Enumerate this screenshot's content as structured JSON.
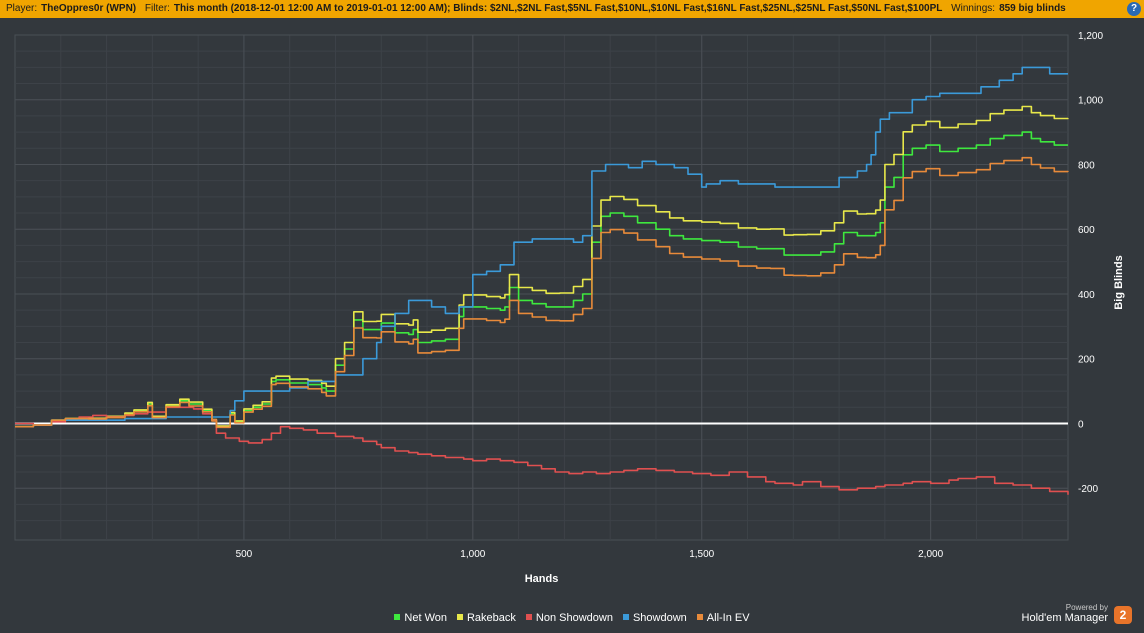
{
  "header": {
    "player_label": "Player:",
    "player_value": "TheOppres0r (WPN)",
    "filter_label": "Filter:",
    "filter_value": "This month (2018-12-01 12:00 AM to 2019-01-01 12:00 AM); Blinds: $2NL,$2NL Fast,$5NL Fast,$10NL,$10NL Fast,$16NL Fast,$25NL,$25NL Fast,$50NL Fast,$100PL",
    "winnings_label": "Winnings:",
    "winnings_value": "859 big blinds",
    "help_glyph": "?"
  },
  "branding": {
    "powered_by": "Powered by",
    "product": "Hold'em Manager",
    "logo_glyph": "2"
  },
  "colors": {
    "background": "#33383d",
    "grid": "#4a4f55",
    "zero_line": "#ffffff",
    "header": "#f0a500"
  },
  "chart_data": {
    "type": "line",
    "xlabel": "Hands",
    "ylabel": "Big Blinds",
    "xlim": [
      0,
      2300
    ],
    "ylim": [
      -360,
      1200
    ],
    "x_ticks": [
      500,
      1000,
      1500,
      2000
    ],
    "x_tick_labels": [
      "500",
      "1,000",
      "1,500",
      "2,000"
    ],
    "y_ticks": [
      -200,
      0,
      200,
      400,
      600,
      800,
      1000,
      1200
    ],
    "y_tick_labels": [
      "-200",
      "0",
      "200",
      "400",
      "600",
      "800",
      "1,000",
      "1,200"
    ],
    "grid": true,
    "legend_position": "bottom",
    "series": [
      {
        "name": "Net Won",
        "color": "#3ee83e",
        "x": [
          0,
          40,
          80,
          110,
          130,
          160,
          200,
          240,
          260,
          290,
          300,
          330,
          360,
          380,
          410,
          430,
          440,
          470,
          480,
          500,
          520,
          540,
          560,
          570,
          600,
          640,
          670,
          680,
          700,
          720,
          740,
          760,
          790,
          800,
          830,
          860,
          870,
          880,
          910,
          940,
          970,
          980,
          1000,
          1030,
          1060,
          1070,
          1080,
          1100,
          1130,
          1160,
          1190,
          1220,
          1240,
          1260,
          1280,
          1300,
          1330,
          1360,
          1400,
          1430,
          1460,
          1500,
          1540,
          1580,
          1620,
          1650,
          1680,
          1700,
          1730,
          1760,
          1790,
          1810,
          1840,
          1860,
          1880,
          1890,
          1900,
          1920,
          1940,
          1960,
          1990,
          2020,
          2060,
          2100,
          2130,
          2160,
          2200,
          2220,
          2240,
          2270,
          2300
        ],
        "y": [
          -10,
          -5,
          10,
          15,
          15,
          15,
          20,
          30,
          40,
          60,
          20,
          55,
          70,
          60,
          40,
          10,
          -10,
          30,
          5,
          40,
          50,
          60,
          130,
          135,
          125,
          120,
          110,
          100,
          180,
          230,
          320,
          290,
          290,
          310,
          280,
          275,
          290,
          250,
          255,
          260,
          330,
          360,
          360,
          355,
          350,
          360,
          420,
          380,
          370,
          360,
          360,
          380,
          400,
          560,
          640,
          650,
          640,
          620,
          600,
          580,
          570,
          565,
          560,
          545,
          540,
          540,
          520,
          520,
          520,
          530,
          555,
          590,
          580,
          580,
          590,
          620,
          730,
          760,
          830,
          850,
          860,
          840,
          850,
          860,
          880,
          890,
          900,
          880,
          870,
          860,
          860
        ]
      },
      {
        "name": "Rakeback",
        "color": "#e8e84a",
        "x": [
          0,
          40,
          80,
          110,
          130,
          160,
          200,
          240,
          260,
          290,
          300,
          330,
          360,
          380,
          410,
          430,
          440,
          470,
          480,
          500,
          520,
          540,
          560,
          570,
          600,
          640,
          670,
          680,
          700,
          720,
          740,
          760,
          790,
          800,
          830,
          860,
          870,
          880,
          910,
          940,
          970,
          980,
          1000,
          1030,
          1060,
          1070,
          1080,
          1100,
          1130,
          1160,
          1190,
          1220,
          1240,
          1260,
          1280,
          1300,
          1330,
          1360,
          1400,
          1430,
          1460,
          1500,
          1540,
          1580,
          1620,
          1650,
          1680,
          1700,
          1730,
          1760,
          1790,
          1810,
          1840,
          1860,
          1880,
          1890,
          1900,
          1920,
          1940,
          1960,
          1990,
          2020,
          2060,
          2100,
          2130,
          2160,
          2200,
          2220,
          2240,
          2270,
          2300
        ],
        "y": [
          -10,
          -5,
          10,
          15,
          15,
          16,
          22,
          32,
          42,
          65,
          22,
          58,
          75,
          66,
          44,
          12,
          -8,
          34,
          8,
          45,
          56,
          67,
          140,
          146,
          137,
          133,
          124,
          115,
          200,
          250,
          345,
          315,
          316,
          337,
          308,
          304,
          320,
          282,
          288,
          294,
          366,
          397,
          397,
          392,
          388,
          398,
          460,
          420,
          411,
          402,
          403,
          423,
          445,
          610,
          690,
          701,
          692,
          673,
          654,
          635,
          626,
          622,
          618,
          604,
          600,
          601,
          582,
          583,
          584,
          595,
          620,
          656,
          647,
          648,
          659,
          690,
          800,
          831,
          901,
          922,
          933,
          914,
          925,
          936,
          957,
          968,
          979,
          960,
          951,
          942,
          943
        ]
      },
      {
        "name": "Non Showdown",
        "color": "#e05050",
        "x": [
          0,
          40,
          80,
          110,
          140,
          170,
          200,
          240,
          260,
          290,
          330,
          360,
          390,
          410,
          430,
          440,
          460,
          490,
          510,
          540,
          560,
          580,
          600,
          630,
          660,
          700,
          740,
          760,
          790,
          800,
          830,
          860,
          880,
          910,
          940,
          980,
          1000,
          1030,
          1060,
          1090,
          1120,
          1150,
          1180,
          1210,
          1240,
          1270,
          1300,
          1330,
          1360,
          1400,
          1440,
          1480,
          1520,
          1560,
          1600,
          1640,
          1660,
          1700,
          1720,
          1760,
          1800,
          1840,
          1880,
          1900,
          1940,
          1960,
          2000,
          2040,
          2060,
          2100,
          2140,
          2180,
          2220,
          2260,
          2300
        ],
        "y": [
          0,
          -5,
          5,
          10,
          20,
          25,
          20,
          25,
          30,
          35,
          50,
          50,
          45,
          30,
          10,
          -30,
          -45,
          -55,
          -60,
          -50,
          -30,
          -10,
          -15,
          -20,
          -30,
          -40,
          -45,
          -55,
          -65,
          -75,
          -85,
          -90,
          -95,
          -100,
          -105,
          -110,
          -115,
          -110,
          -115,
          -120,
          -130,
          -140,
          -150,
          -155,
          -150,
          -155,
          -150,
          -145,
          -140,
          -145,
          -150,
          -155,
          -160,
          -150,
          -165,
          -180,
          -185,
          -190,
          -180,
          -195,
          -205,
          -200,
          -195,
          -190,
          -185,
          -180,
          -185,
          -175,
          -170,
          -165,
          -185,
          -190,
          -200,
          -210,
          -220
        ]
      },
      {
        "name": "Showdown",
        "color": "#3b9ad9",
        "x": [
          0,
          40,
          80,
          110,
          140,
          170,
          200,
          240,
          260,
          290,
          330,
          360,
          390,
          410,
          430,
          440,
          470,
          480,
          500,
          520,
          560,
          600,
          640,
          680,
          700,
          720,
          740,
          760,
          790,
          800,
          830,
          860,
          880,
          910,
          940,
          960,
          970,
          1000,
          1030,
          1060,
          1090,
          1130,
          1160,
          1190,
          1220,
          1240,
          1260,
          1290,
          1320,
          1340,
          1370,
          1400,
          1440,
          1470,
          1500,
          1510,
          1540,
          1580,
          1620,
          1660,
          1700,
          1730,
          1760,
          1800,
          1840,
          1860,
          1870,
          1880,
          1890,
          1910,
          1930,
          1960,
          1990,
          2020,
          2040,
          2080,
          2110,
          2150,
          2180,
          2200,
          2230,
          2260,
          2300
        ],
        "y": [
          -10,
          -5,
          10,
          10,
          10,
          10,
          10,
          15,
          15,
          15,
          20,
          20,
          20,
          20,
          20,
          20,
          40,
          70,
          100,
          100,
          100,
          110,
          130,
          130,
          150,
          150,
          150,
          200,
          250,
          300,
          340,
          380,
          380,
          360,
          340,
          340,
          360,
          460,
          470,
          490,
          560,
          570,
          570,
          570,
          560,
          580,
          780,
          800,
          800,
          790,
          810,
          800,
          790,
          770,
          730,
          740,
          750,
          740,
          740,
          730,
          730,
          730,
          730,
          760,
          780,
          800,
          830,
          900,
          940,
          960,
          960,
          1000,
          1010,
          1020,
          1020,
          1020,
          1040,
          1060,
          1080,
          1100,
          1100,
          1080,
          1080
        ]
      },
      {
        "name": "All-In EV",
        "color": "#e88a3a",
        "x": [
          0,
          40,
          80,
          110,
          130,
          160,
          200,
          240,
          260,
          290,
          300,
          330,
          360,
          380,
          410,
          430,
          440,
          470,
          480,
          500,
          520,
          540,
          560,
          570,
          600,
          640,
          670,
          680,
          700,
          720,
          740,
          760,
          790,
          800,
          830,
          860,
          870,
          880,
          910,
          940,
          970,
          980,
          1000,
          1030,
          1060,
          1070,
          1080,
          1100,
          1130,
          1160,
          1190,
          1220,
          1240,
          1260,
          1280,
          1300,
          1330,
          1360,
          1400,
          1430,
          1460,
          1500,
          1540,
          1580,
          1620,
          1650,
          1680,
          1700,
          1730,
          1760,
          1790,
          1810,
          1840,
          1860,
          1880,
          1890,
          1900,
          1920,
          1940,
          1960,
          1990,
          2020,
          2060,
          2100,
          2130,
          2160,
          2200,
          2220,
          2240,
          2270,
          2300
        ],
        "y": [
          -10,
          -5,
          10,
          15,
          15,
          14,
          18,
          27,
          36,
          55,
          18,
          52,
          65,
          54,
          36,
          8,
          -12,
          26,
          2,
          35,
          44,
          53,
          120,
          124,
          113,
          107,
          96,
          85,
          160,
          210,
          295,
          265,
          264,
          283,
          252,
          246,
          260,
          218,
          222,
          226,
          294,
          323,
          323,
          318,
          312,
          322,
          380,
          340,
          329,
          318,
          317,
          337,
          355,
          510,
          590,
          599,
          588,
          567,
          546,
          525,
          514,
          508,
          502,
          486,
          480,
          479,
          458,
          457,
          456,
          465,
          490,
          524,
          513,
          512,
          521,
          550,
          660,
          689,
          759,
          778,
          787,
          766,
          775,
          784,
          803,
          812,
          821,
          800,
          789,
          778,
          777
        ]
      }
    ]
  }
}
